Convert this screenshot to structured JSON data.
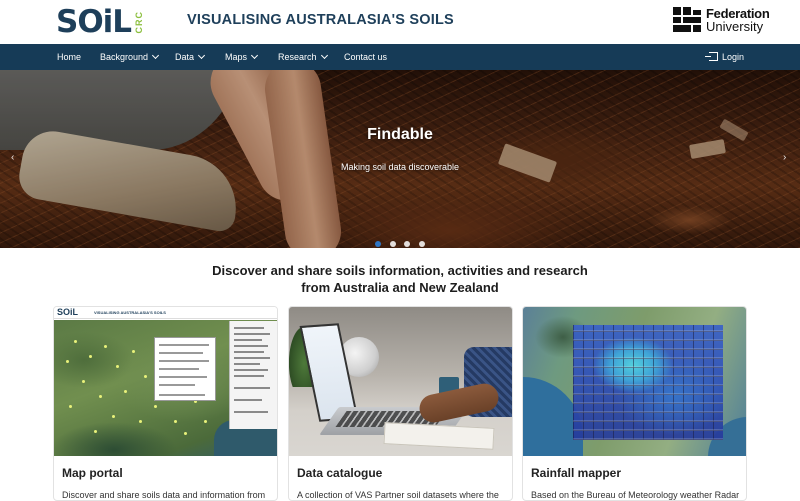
{
  "header": {
    "logo_main": "SOiL",
    "logo_side": "CRC",
    "site_title": "VISUALISING AUSTRALASIA'S SOILS",
    "partner_logo_line1": "Federation",
    "partner_logo_line2": "University"
  },
  "nav": {
    "items": [
      {
        "label": "Home",
        "has_dropdown": false
      },
      {
        "label": "Background",
        "has_dropdown": true
      },
      {
        "label": "Data",
        "has_dropdown": true
      },
      {
        "label": "Maps",
        "has_dropdown": true
      },
      {
        "label": "Research",
        "has_dropdown": true
      },
      {
        "label": "Contact us",
        "has_dropdown": false
      }
    ],
    "login_label": "Login"
  },
  "hero": {
    "title": "Findable",
    "subtitle": "Making soil data discoverable",
    "slide_count": 4,
    "active_slide": 1
  },
  "section": {
    "heading_line1": "Discover and share soils information, activities and research",
    "heading_line2": "from Australia and New Zealand"
  },
  "cards": [
    {
      "title": "Map portal",
      "text": "Discover and share soils data and information from"
    },
    {
      "title": "Data catalogue",
      "text": "A collection of VAS Partner soil datasets where the"
    },
    {
      "title": "Rainfall mapper",
      "text": "Based on the Bureau of Meteorology weather Radar"
    }
  ],
  "card1_thumb": {
    "logo": "SOiL",
    "title": "VISUALISING AUSTRALASIA'S SOILS"
  },
  "colors": {
    "nav_bg": "#163b57",
    "brand_dark": "#1e3f5a",
    "brand_green": "#8cbf3f",
    "active_dot": "#2f76c4"
  }
}
